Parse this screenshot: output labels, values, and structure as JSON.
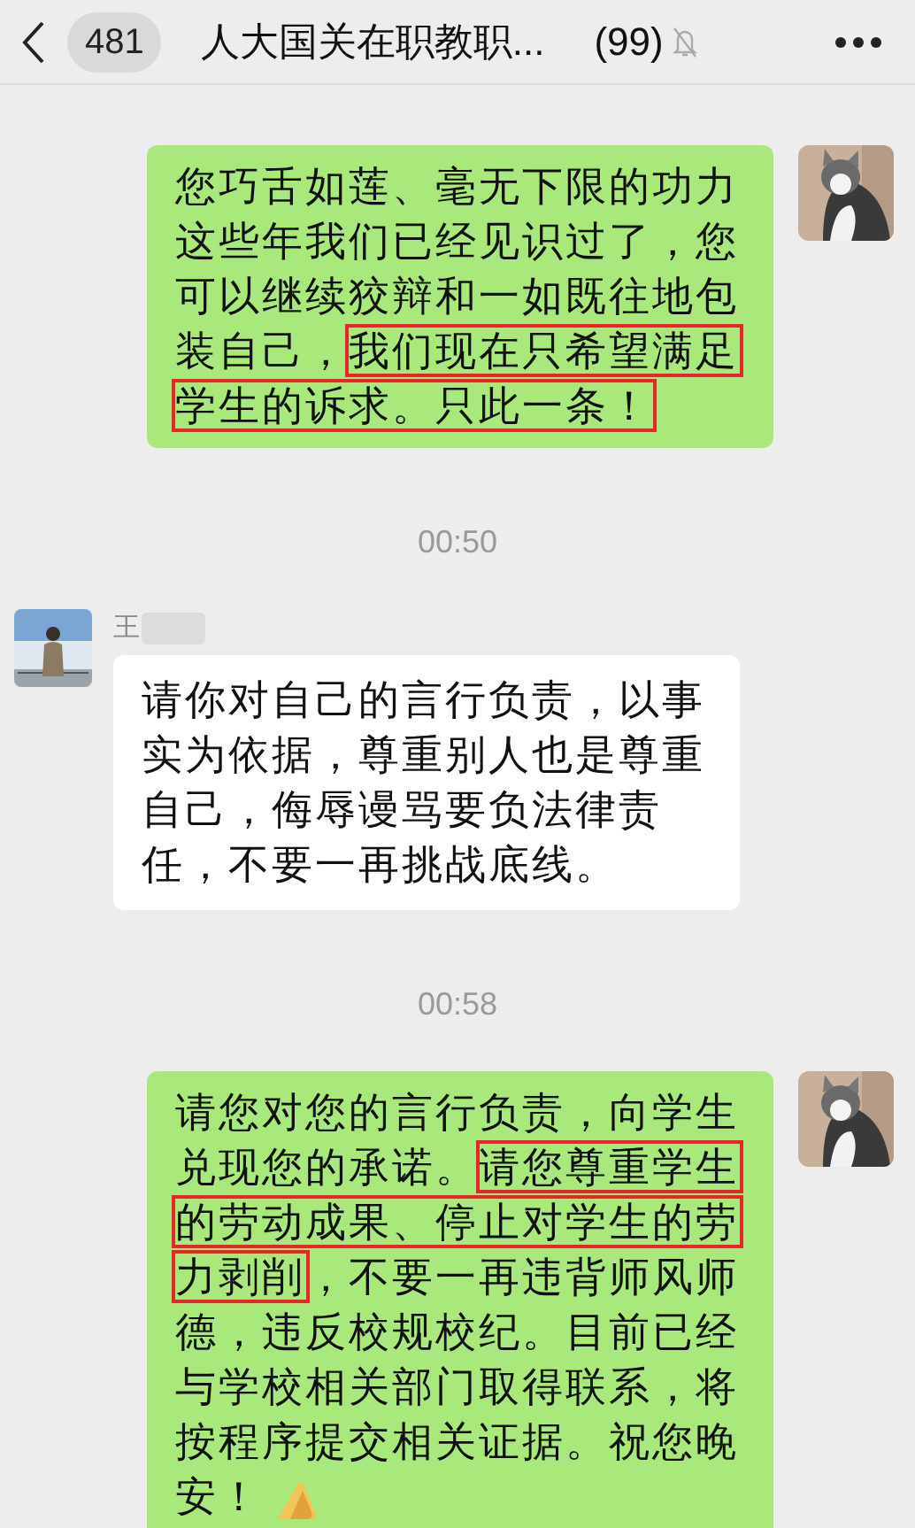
{
  "header": {
    "unread_count": "481",
    "title": "人大国关在职教职...",
    "member_count": "(99)",
    "muted": true
  },
  "messages": [
    {
      "kind": "outgoing",
      "segments": [
        {
          "text": "您巧舌如莲、毫无下限的功力这些年我们已经见识过了，您可以继续狡辩和一如既往地包装自己，",
          "highlighted": false
        },
        {
          "text": "我们现在只希望满足学生的诉求。只此一条！",
          "highlighted": true
        }
      ],
      "emoji": false
    },
    {
      "kind": "time",
      "text": "00:50"
    },
    {
      "kind": "incoming",
      "sender": "王",
      "sender_redacted": true,
      "segments": [
        {
          "text": "请你对自己的言行负责，以事实为依据，尊重别人也是尊重自己，侮辱谩骂要负法律责任，不要一再挑战底线。",
          "highlighted": false
        }
      ],
      "emoji": false
    },
    {
      "kind": "time",
      "text": "00:58"
    },
    {
      "kind": "outgoing",
      "segments": [
        {
          "text": "请您对您的言行负责，向学生兑现您的承诺。",
          "highlighted": false
        },
        {
          "text": "请您尊重学生的劳动成果、停止对学生的劳力剥削",
          "highlighted": true
        },
        {
          "text": "，不要一再违背师风师德，违反校规校纪。目前已经与学校相关部门取得联系，将按程序提交相关证据。祝您晚安！",
          "highlighted": false
        }
      ],
      "emoji": true
    }
  ]
}
